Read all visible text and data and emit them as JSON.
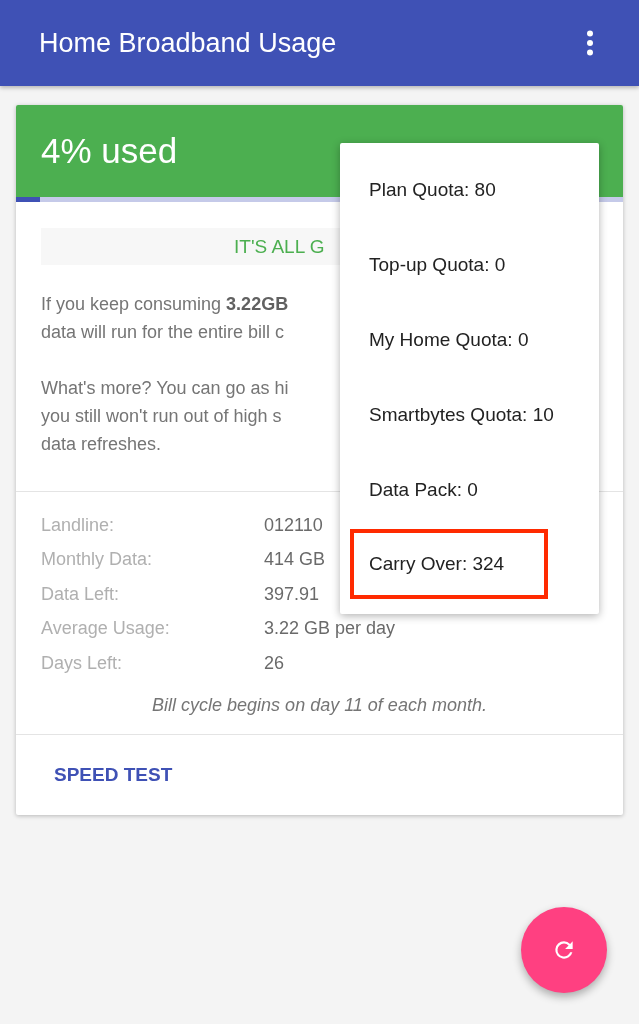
{
  "app_bar": {
    "title": "Home Broadband Usage"
  },
  "usage": {
    "headline": "4% used",
    "level": 0.04,
    "status": "IT'S ALL G",
    "paragraphs": [
      "If you keep consuming **3.22GB**",
      "data will run for the entire bill c",
      "What's more? You can go as hi",
      "you still won't run out of high s",
      "data refreshes."
    ],
    "details": [
      {
        "label": "Landline:",
        "value": "012110"
      },
      {
        "label": "Monthly Data:",
        "value": "414 GB"
      },
      {
        "label": "Data Left:",
        "value": "397.91"
      },
      {
        "label": "Average Usage:",
        "value": "3.22 GB per day"
      },
      {
        "label": "Days Left:",
        "value": "26"
      }
    ],
    "note": "Bill cycle begins on day 11 of each month.",
    "action": "SPEED TEST"
  },
  "menu": [
    {
      "label": "Plan Quota: 80",
      "highlighted": false
    },
    {
      "label": "Top-up Quota: 0",
      "highlighted": false
    },
    {
      "label": "My Home Quota: 0",
      "highlighted": false
    },
    {
      "label": "Smartbytes Quota: 10",
      "highlighted": false
    },
    {
      "label": "Data Pack: 0",
      "highlighted": false
    },
    {
      "label": "Carry Over: 324",
      "highlighted": true
    }
  ]
}
